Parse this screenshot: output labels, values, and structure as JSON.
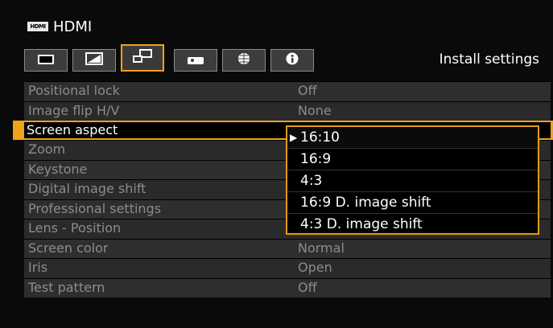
{
  "source": {
    "badge": "HDMI",
    "label": "HDMI"
  },
  "tabs": [
    {
      "name": "image-tab",
      "icon": "image-adjust-icon"
    },
    {
      "name": "advanced-image-tab",
      "icon": "advanced-image-icon"
    },
    {
      "name": "install-tab",
      "icon": "install-settings-icon"
    },
    {
      "name": "system-tab",
      "icon": "projector-icon"
    },
    {
      "name": "network-tab",
      "icon": "globe-icon"
    },
    {
      "name": "info-tab",
      "icon": "info-icon"
    }
  ],
  "active_tab_title": "Install settings",
  "menu": [
    {
      "label": "Positional lock",
      "value": "Off"
    },
    {
      "label": "Image flip H/V",
      "value": "None"
    },
    {
      "label": "Screen aspect",
      "value": ""
    },
    {
      "label": "Zoom",
      "value": ""
    },
    {
      "label": "Keystone",
      "value": ""
    },
    {
      "label": "Digital image shift",
      "value": ""
    },
    {
      "label": "Professional settings",
      "value": ""
    },
    {
      "label": "Lens - Position",
      "value": ""
    },
    {
      "label": "Screen color",
      "value": "Normal"
    },
    {
      "label": "Iris",
      "value": "Open"
    },
    {
      "label": "Test pattern",
      "value": "Off"
    }
  ],
  "dropdown": {
    "options": [
      "16:10",
      "16:9",
      "4:3",
      "16:9 D. image shift",
      "4:3 D. image shift"
    ],
    "current": "16:10"
  },
  "colors": {
    "accent": "#f0a21a"
  }
}
